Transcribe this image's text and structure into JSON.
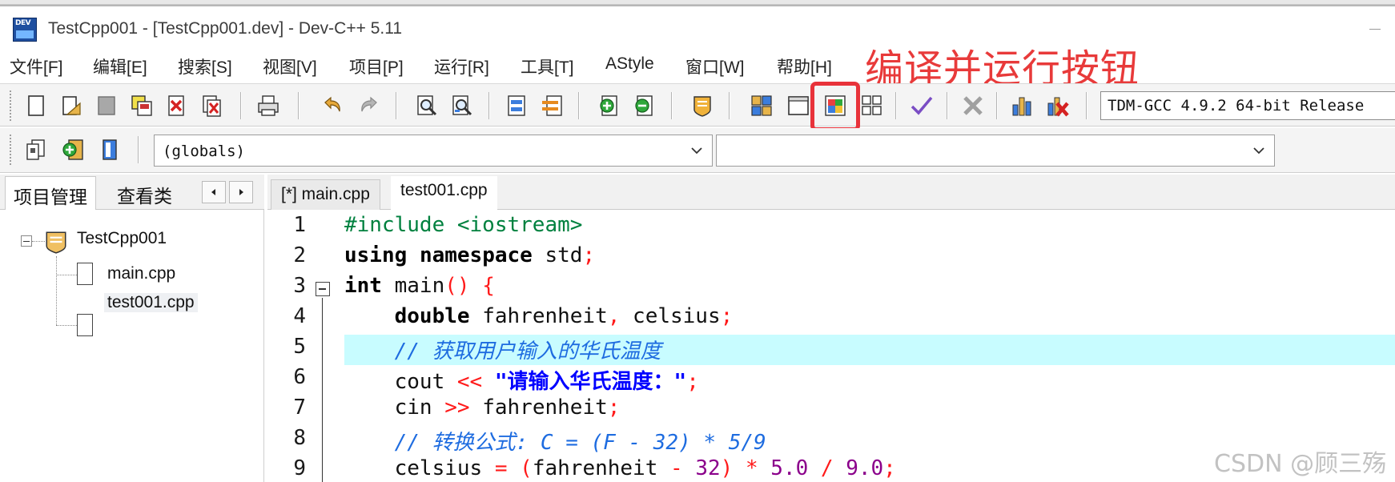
{
  "window": {
    "title": "TestCpp001 - [TestCpp001.dev] - Dev-C++ 5.11",
    "logo_text": "DEV"
  },
  "menu": {
    "items": [
      "文件[F]",
      "编辑[E]",
      "搜索[S]",
      "视图[V]",
      "项目[P]",
      "运行[R]",
      "工具[T]",
      "AStyle",
      "窗口[W]",
      "帮助[H]"
    ]
  },
  "annotation": {
    "text": "编译并运行按钮",
    "color": "#e83a3a"
  },
  "toolbar": {
    "compiler_value": "TDM-GCC 4.9.2 64-bit Release"
  },
  "toolbar2": {
    "scope_combo_value": "(globals)",
    "member_combo_value": ""
  },
  "left_panel": {
    "tabs": [
      "项目管理",
      "查看类"
    ],
    "tree": {
      "project": "TestCpp001",
      "files": [
        "main.cpp",
        "test001.cpp"
      ]
    }
  },
  "editor": {
    "tabs": [
      "[*] main.cpp",
      "test001.cpp"
    ],
    "active_tab": "test001.cpp",
    "highlighted_line": 5,
    "line_numbers": [
      "1",
      "2",
      "3",
      "4",
      "5",
      "6",
      "7",
      "8",
      "9"
    ],
    "lines": {
      "l1": {
        "preproc": "#include <iostream>"
      },
      "l2": {
        "kw1": "using",
        "kw2": "namespace",
        "rest": " std",
        "semi": ";"
      },
      "l3": {
        "kw": "int",
        "rest": " main",
        "paren": "()",
        "brace": " {"
      },
      "l4": {
        "kw": "double",
        "a": " fahrenheit",
        "comma": ",",
        "b": " celsius",
        "semi": ";"
      },
      "l5": {
        "comment": "// 获取用户输入的华氏温度"
      },
      "l6": {
        "a": "cout ",
        "op": "<<",
        "str": " \"请输入华氏温度：\"",
        "semi": ";"
      },
      "l7": {
        "a": "cin ",
        "op": ">>",
        "b": " fahrenheit",
        "semi": ";"
      },
      "l8": {
        "comment": "// 转换公式: C = (F - 32) * 5/9"
      },
      "l9": {
        "a": "celsius ",
        "eq": "=",
        "lp": " (",
        "b": "fahrenheit ",
        "minus": "-",
        "n1": " 32",
        "rp": ")",
        "mul": " *",
        "n2": " 5.0",
        "div": " /",
        "n3": " 9.0",
        "semi": ";"
      }
    }
  },
  "watermark": "CSDN @顾三殇"
}
